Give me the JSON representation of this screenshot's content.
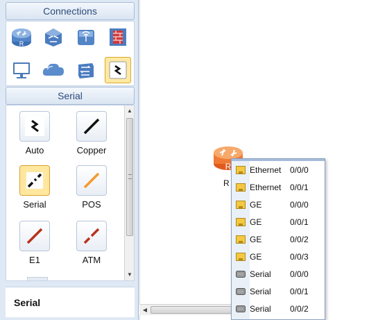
{
  "colors": {
    "panel_bg": "#dfe9f5",
    "selected": "#ffe7a0",
    "ethernet_port": "#f2c43c",
    "serial_port": "#8a8a8a"
  },
  "left_panel": {
    "connections_header": "Connections",
    "connection_icons": [
      "router-icon",
      "switch-icon",
      "wireless-icon",
      "firewall-icon",
      "pc-icon",
      "cloud-icon",
      "hub-icon",
      "connection-cable-icon"
    ],
    "serial_header": "Serial",
    "cables": [
      {
        "label": "Auto",
        "icon": "auto-cable-icon"
      },
      {
        "label": "Copper",
        "icon": "copper-cable-icon"
      },
      {
        "label": "Serial",
        "icon": "serial-cable-icon",
        "selected": true
      },
      {
        "label": "POS",
        "icon": "pos-cable-icon"
      },
      {
        "label": "E1",
        "icon": "e1-cable-icon"
      },
      {
        "label": "ATM",
        "icon": "atm-cable-icon"
      }
    ],
    "selected_cable": "Serial"
  },
  "canvas": {
    "device_label": "R"
  },
  "port_menu": {
    "items": [
      {
        "type": "Ethernet",
        "port": "0/0/0",
        "icon": "ethernet-port-icon"
      },
      {
        "type": "Ethernet",
        "port": "0/0/1",
        "icon": "ethernet-port-icon"
      },
      {
        "type": "GE",
        "port": "0/0/0",
        "icon": "ethernet-port-icon"
      },
      {
        "type": "GE",
        "port": "0/0/1",
        "icon": "ethernet-port-icon"
      },
      {
        "type": "GE",
        "port": "0/0/2",
        "icon": "ethernet-port-icon"
      },
      {
        "type": "GE",
        "port": "0/0/3",
        "icon": "ethernet-port-icon"
      },
      {
        "type": "Serial",
        "port": "0/0/0",
        "icon": "serial-port-icon"
      },
      {
        "type": "Serial",
        "port": "0/0/1",
        "icon": "serial-port-icon"
      },
      {
        "type": "Serial",
        "port": "0/0/2",
        "icon": "serial-port-icon"
      }
    ]
  }
}
